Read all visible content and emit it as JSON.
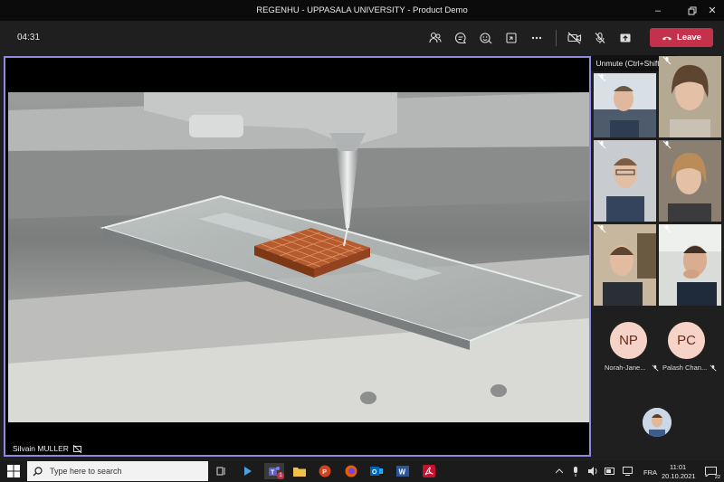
{
  "window": {
    "title": "REGENHU - UPPASALA UNIVERSITY - Product Demo"
  },
  "toolbar": {
    "timer": "04:31",
    "leave_label": "Leave"
  },
  "tooltip": {
    "text": "Unmute (Ctrl+Shift+M)"
  },
  "main_video": {
    "speaker_name": "Silvain MULLER"
  },
  "participants": [
    {
      "initials": "NP",
      "name": "Norah-Jane..."
    },
    {
      "initials": "PC",
      "name": "Palash Chan..."
    }
  ],
  "taskbar": {
    "search_placeholder": "Type here to search",
    "language": "FRA",
    "time": "11:01",
    "date": "20.10.2021",
    "notification_count": "22",
    "teams_badge": "1"
  },
  "colors": {
    "leave": "#c4314b",
    "active_border": "#8f8ae0",
    "avatar_bg": "#f5d3c7"
  }
}
